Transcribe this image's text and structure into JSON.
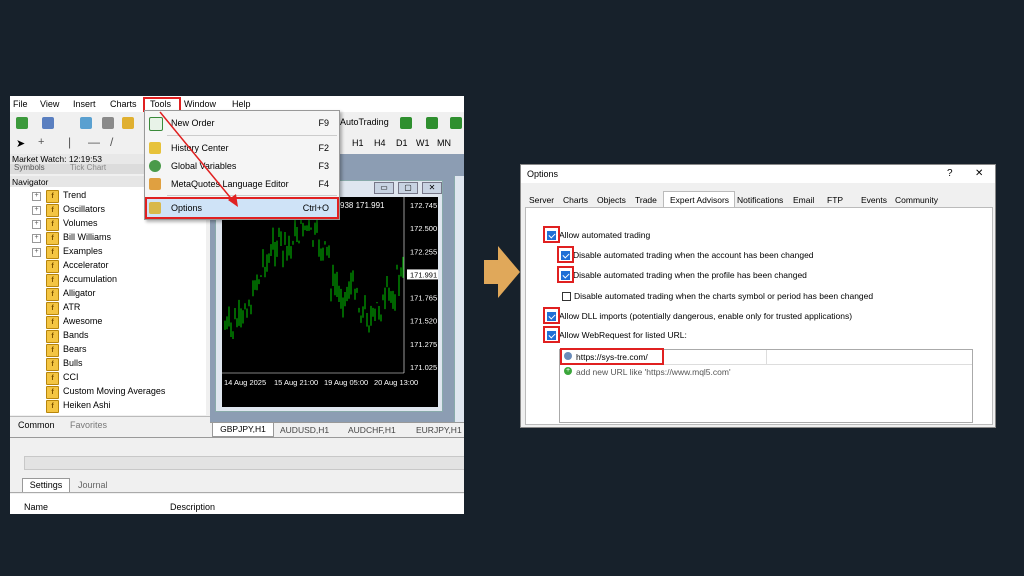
{
  "mt4": {
    "menu": [
      "File",
      "View",
      "Insert",
      "Charts",
      "Tools",
      "Window",
      "Help"
    ],
    "toolbar": {
      "autotrading": "AutoTrading"
    },
    "timeframes": [
      "H1",
      "H4",
      "D1",
      "W1",
      "MN"
    ],
    "market_watch": "Market Watch: 12:19:53",
    "market_watch_tabs": [
      "Symbols",
      "Tick Chart"
    ],
    "navigator_title": "Navigator",
    "navigator_items": [
      {
        "label": "Trend",
        "expand": "+"
      },
      {
        "label": "Oscillators",
        "expand": "+"
      },
      {
        "label": "Volumes",
        "expand": "+"
      },
      {
        "label": "Bill Williams",
        "expand": "+"
      },
      {
        "label": "Examples",
        "expand": "+"
      },
      {
        "label": "Accelerator",
        "expand": ""
      },
      {
        "label": "Accumulation",
        "expand": ""
      },
      {
        "label": "Alligator",
        "expand": ""
      },
      {
        "label": "ATR",
        "expand": ""
      },
      {
        "label": "Awesome",
        "expand": ""
      },
      {
        "label": "Bands",
        "expand": ""
      },
      {
        "label": "Bears",
        "expand": ""
      },
      {
        "label": "Bulls",
        "expand": ""
      },
      {
        "label": "CCI",
        "expand": ""
      },
      {
        "label": "Custom Moving Averages",
        "expand": ""
      },
      {
        "label": "Heiken Ashi",
        "expand": ""
      }
    ],
    "nav_tabs": [
      "Common",
      "Favorites"
    ],
    "tools_menu": [
      {
        "label": "New Order",
        "shortcut": "F9"
      },
      {
        "label": "History Center",
        "shortcut": "F2"
      },
      {
        "label": "Global Variables",
        "shortcut": "F3"
      },
      {
        "label": "MetaQuotes Language Editor",
        "shortcut": "F4"
      },
      {
        "label": "Options",
        "shortcut": "Ctrl+O"
      }
    ],
    "chart": {
      "price_header": "938 171.991",
      "prices": [
        "172.745",
        "172.500",
        "172.255",
        "171.991",
        "171.765",
        "171.520",
        "171.275",
        "171.025"
      ],
      "current_price": "171.991",
      "dates": [
        "14 Aug 2025",
        "15 Aug 21:00",
        "19 Aug 05:00",
        "20 Aug 13:00"
      ]
    },
    "chart_tabs": [
      "GBPJPY,H1",
      "AUDUSD,H1",
      "AUDCHF,H1",
      "EURJPY,H1"
    ],
    "bottom_tabs": [
      "Settings",
      "Journal"
    ],
    "bottom_columns": [
      "Name",
      "Description"
    ]
  },
  "options": {
    "title": "Options",
    "help": "?",
    "close": "✕",
    "tabs": [
      "Server",
      "Charts",
      "Objects",
      "Trade",
      "Expert Advisors",
      "Notifications",
      "Email",
      "FTP",
      "Events",
      "Community"
    ],
    "active_tab": "Expert Advisors",
    "settings": [
      {
        "label": "Allow automated trading",
        "checked": true
      },
      {
        "label": "Disable automated trading when the account has been changed",
        "checked": true
      },
      {
        "label": "Disable automated trading when the profile has been changed",
        "checked": true
      },
      {
        "label": "Disable automated trading when the charts symbol or period has been changed",
        "checked": false
      },
      {
        "label": "Allow DLL imports (potentially dangerous, enable only for trusted applications)",
        "checked": true
      },
      {
        "label": "Allow WebRequest for listed URL:",
        "checked": true
      }
    ],
    "urls": [
      "https://sys-tre.com/"
    ],
    "add_url": "add new URL like 'https://www.mql5.com'"
  },
  "colors": {
    "background": "#17212b",
    "highlight": "#e02020",
    "arrow": "#e0a85a",
    "chart_bg": "#000000",
    "candles": "#00c800"
  }
}
